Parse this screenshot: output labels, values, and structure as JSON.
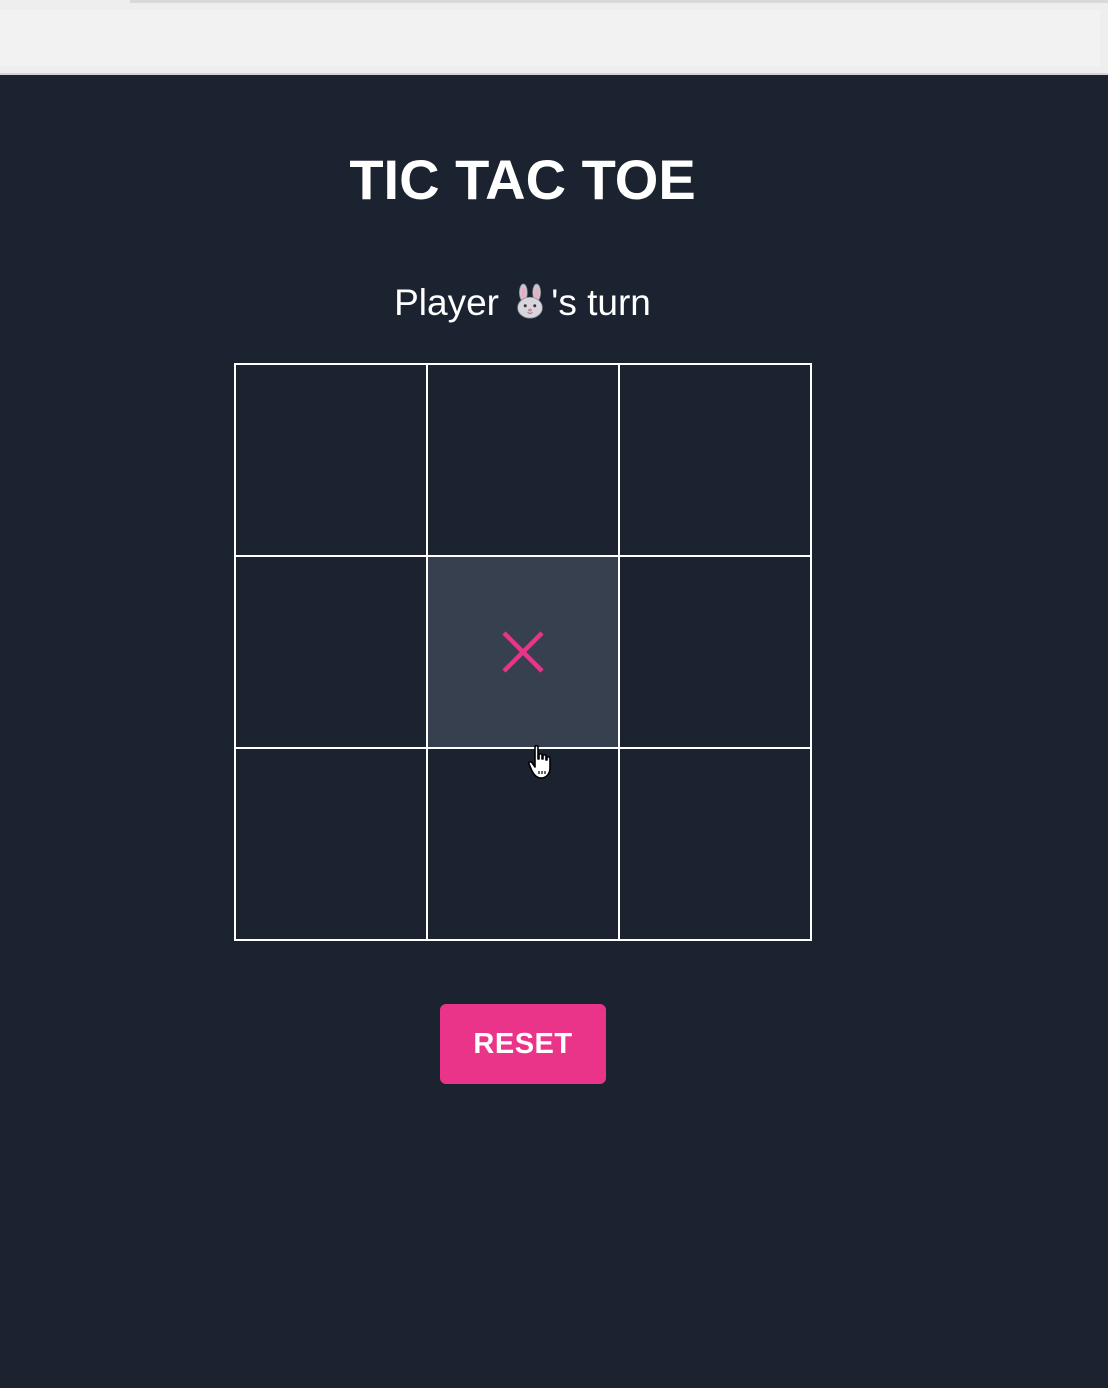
{
  "game": {
    "title": "TIC TAC TOE",
    "status_prefix": "Player ",
    "status_suffix": "'s turn",
    "current_player_icon": "rabbit-face-icon",
    "board": [
      [
        "",
        "",
        ""
      ],
      [
        "",
        "X",
        ""
      ],
      [
        "",
        "",
        ""
      ]
    ],
    "hovered_cell": [
      1,
      1
    ],
    "reset_label": "RESET"
  },
  "colors": {
    "background": "#1b2330",
    "grid_lines": "#ffffff",
    "accent": "#e9348a",
    "hover_cell": "#37404f"
  }
}
